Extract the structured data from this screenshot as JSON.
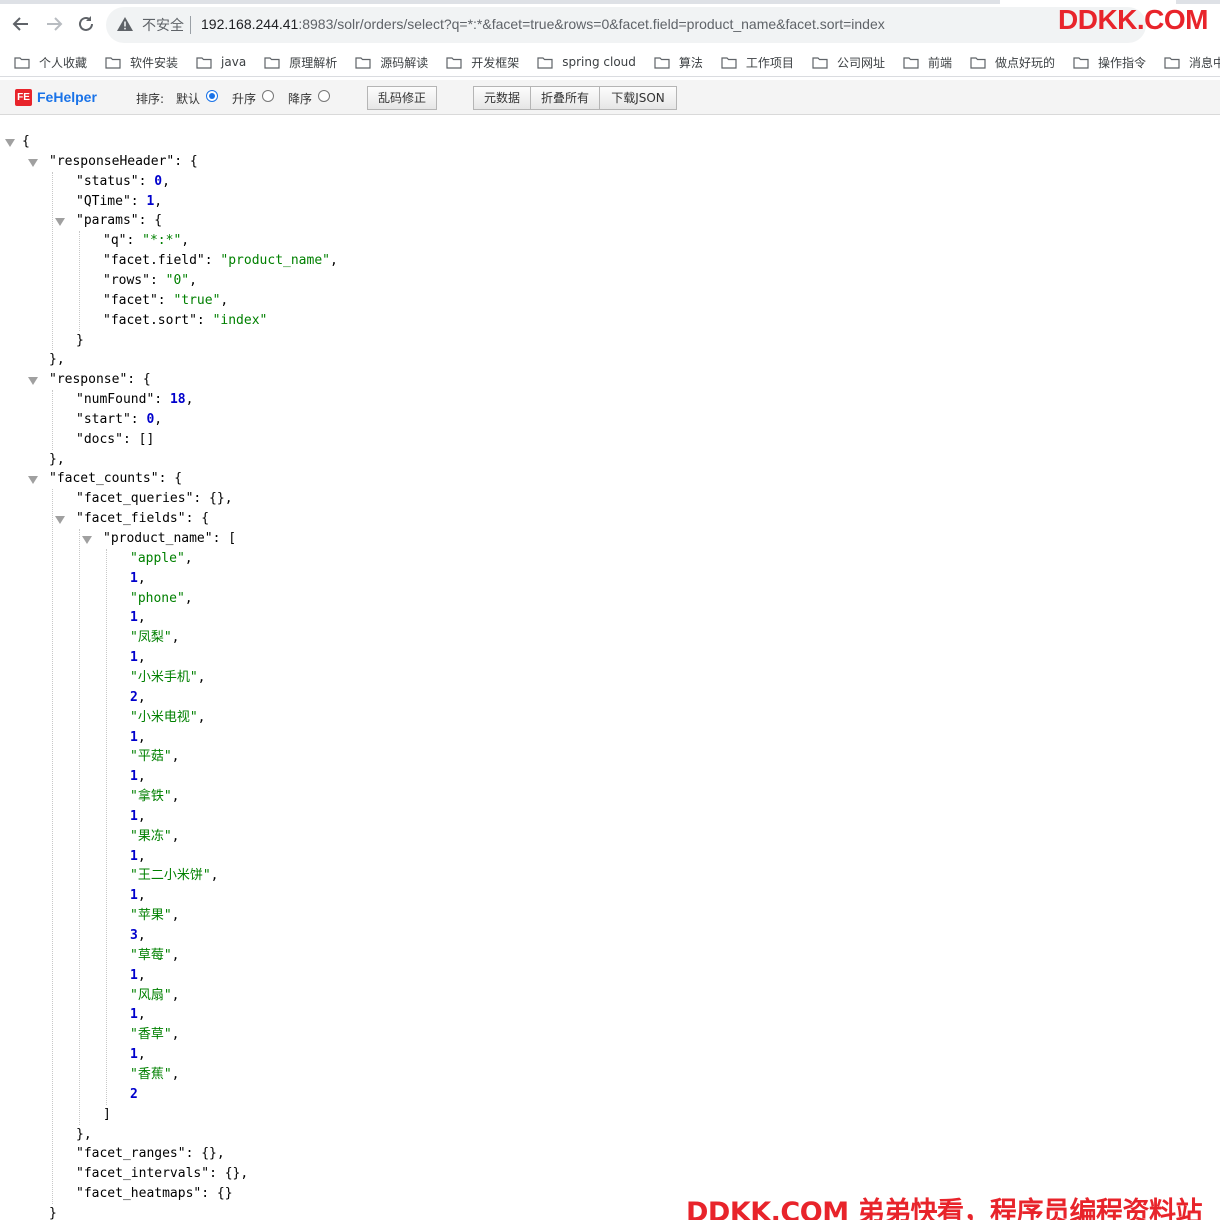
{
  "address_bar": {
    "security_label": "不安全",
    "url_host": "192.168.244.41",
    "url_rest": ":8983/solr/orders/select?q=*:*&facet=true&rows=0&facet.field=product_name&facet.sort=index"
  },
  "watermark_top": "DDKK.COM",
  "watermark_bottom": "DDKK.COM 弟弟快看，程序员编程资料站",
  "bookmarks": [
    "个人收藏",
    "软件安装",
    "java",
    "原理解析",
    "源码解读",
    "开发框架",
    "spring cloud",
    "算法",
    "工作项目",
    "公司网址",
    "前端",
    "做点好玩的",
    "操作指令",
    "消息中间件"
  ],
  "fehelper": {
    "brand": "FeHelper",
    "logo_text": "FE",
    "sort_label": "排序:",
    "sort_default": "默认",
    "sort_asc": "升序",
    "sort_desc": "降序",
    "sort_selected": "默认",
    "fix_encoding": "乱码修正",
    "metadata": "元数据",
    "collapse_all": "折叠所有",
    "download_json": "下载JSON"
  },
  "json_lines": [
    {
      "indent": 0,
      "tokens": [
        [
          "p",
          "{"
        ]
      ]
    },
    {
      "indent": 1,
      "tokens": [
        [
          "k",
          "\"responseHeader\""
        ],
        [
          "p",
          ": {"
        ]
      ]
    },
    {
      "indent": 2,
      "tokens": [
        [
          "k",
          "\"status\""
        ],
        [
          "p",
          ": "
        ],
        [
          "n",
          "0"
        ],
        [
          "p",
          ","
        ]
      ]
    },
    {
      "indent": 2,
      "tokens": [
        [
          "k",
          "\"QTime\""
        ],
        [
          "p",
          ": "
        ],
        [
          "n",
          "1"
        ],
        [
          "p",
          ","
        ]
      ]
    },
    {
      "indent": 2,
      "tokens": [
        [
          "k",
          "\"params\""
        ],
        [
          "p",
          ": {"
        ]
      ]
    },
    {
      "indent": 3,
      "tokens": [
        [
          "k",
          "\"q\""
        ],
        [
          "p",
          ": "
        ],
        [
          "s",
          "\"*:*\""
        ],
        [
          "p",
          ","
        ]
      ]
    },
    {
      "indent": 3,
      "tokens": [
        [
          "k",
          "\"facet.field\""
        ],
        [
          "p",
          ": "
        ],
        [
          "s",
          "\"product_name\""
        ],
        [
          "p",
          ","
        ]
      ]
    },
    {
      "indent": 3,
      "tokens": [
        [
          "k",
          "\"rows\""
        ],
        [
          "p",
          ": "
        ],
        [
          "s",
          "\"0\""
        ],
        [
          "p",
          ","
        ]
      ]
    },
    {
      "indent": 3,
      "tokens": [
        [
          "k",
          "\"facet\""
        ],
        [
          "p",
          ": "
        ],
        [
          "s",
          "\"true\""
        ],
        [
          "p",
          ","
        ]
      ]
    },
    {
      "indent": 3,
      "tokens": [
        [
          "k",
          "\"facet.sort\""
        ],
        [
          "p",
          ": "
        ],
        [
          "s",
          "\"index\""
        ]
      ]
    },
    {
      "indent": 2,
      "tokens": [
        [
          "p",
          "}"
        ]
      ]
    },
    {
      "indent": 1,
      "tokens": [
        [
          "p",
          "},"
        ]
      ]
    },
    {
      "indent": 1,
      "tokens": [
        [
          "k",
          "\"response\""
        ],
        [
          "p",
          ": {"
        ]
      ]
    },
    {
      "indent": 2,
      "tokens": [
        [
          "k",
          "\"numFound\""
        ],
        [
          "p",
          ": "
        ],
        [
          "n",
          "18"
        ],
        [
          "p",
          ","
        ]
      ]
    },
    {
      "indent": 2,
      "tokens": [
        [
          "k",
          "\"start\""
        ],
        [
          "p",
          ": "
        ],
        [
          "n",
          "0"
        ],
        [
          "p",
          ","
        ]
      ]
    },
    {
      "indent": 2,
      "tokens": [
        [
          "k",
          "\"docs\""
        ],
        [
          "p",
          ": []"
        ]
      ]
    },
    {
      "indent": 1,
      "tokens": [
        [
          "p",
          "},"
        ]
      ]
    },
    {
      "indent": 1,
      "tokens": [
        [
          "k",
          "\"facet_counts\""
        ],
        [
          "p",
          ": {"
        ]
      ]
    },
    {
      "indent": 2,
      "tokens": [
        [
          "k",
          "\"facet_queries\""
        ],
        [
          "p",
          ": {},"
        ]
      ]
    },
    {
      "indent": 2,
      "tokens": [
        [
          "k",
          "\"facet_fields\""
        ],
        [
          "p",
          ": {"
        ]
      ]
    },
    {
      "indent": 3,
      "tokens": [
        [
          "k",
          "\"product_name\""
        ],
        [
          "p",
          ": ["
        ]
      ]
    },
    {
      "indent": 4,
      "tokens": [
        [
          "s",
          "\"apple\""
        ],
        [
          "p",
          ","
        ]
      ]
    },
    {
      "indent": 4,
      "tokens": [
        [
          "n",
          "1"
        ],
        [
          "p",
          ","
        ]
      ]
    },
    {
      "indent": 4,
      "tokens": [
        [
          "s",
          "\"phone\""
        ],
        [
          "p",
          ","
        ]
      ]
    },
    {
      "indent": 4,
      "tokens": [
        [
          "n",
          "1"
        ],
        [
          "p",
          ","
        ]
      ]
    },
    {
      "indent": 4,
      "tokens": [
        [
          "s",
          "\"凤梨\""
        ],
        [
          "p",
          ","
        ]
      ]
    },
    {
      "indent": 4,
      "tokens": [
        [
          "n",
          "1"
        ],
        [
          "p",
          ","
        ]
      ]
    },
    {
      "indent": 4,
      "tokens": [
        [
          "s",
          "\"小米手机\""
        ],
        [
          "p",
          ","
        ]
      ]
    },
    {
      "indent": 4,
      "tokens": [
        [
          "n",
          "2"
        ],
        [
          "p",
          ","
        ]
      ]
    },
    {
      "indent": 4,
      "tokens": [
        [
          "s",
          "\"小米电视\""
        ],
        [
          "p",
          ","
        ]
      ]
    },
    {
      "indent": 4,
      "tokens": [
        [
          "n",
          "1"
        ],
        [
          "p",
          ","
        ]
      ]
    },
    {
      "indent": 4,
      "tokens": [
        [
          "s",
          "\"平菇\""
        ],
        [
          "p",
          ","
        ]
      ]
    },
    {
      "indent": 4,
      "tokens": [
        [
          "n",
          "1"
        ],
        [
          "p",
          ","
        ]
      ]
    },
    {
      "indent": 4,
      "tokens": [
        [
          "s",
          "\"拿铁\""
        ],
        [
          "p",
          ","
        ]
      ]
    },
    {
      "indent": 4,
      "tokens": [
        [
          "n",
          "1"
        ],
        [
          "p",
          ","
        ]
      ]
    },
    {
      "indent": 4,
      "tokens": [
        [
          "s",
          "\"果冻\""
        ],
        [
          "p",
          ","
        ]
      ]
    },
    {
      "indent": 4,
      "tokens": [
        [
          "n",
          "1"
        ],
        [
          "p",
          ","
        ]
      ]
    },
    {
      "indent": 4,
      "tokens": [
        [
          "s",
          "\"王二小米饼\""
        ],
        [
          "p",
          ","
        ]
      ]
    },
    {
      "indent": 4,
      "tokens": [
        [
          "n",
          "1"
        ],
        [
          "p",
          ","
        ]
      ]
    },
    {
      "indent": 4,
      "tokens": [
        [
          "s",
          "\"苹果\""
        ],
        [
          "p",
          ","
        ]
      ]
    },
    {
      "indent": 4,
      "tokens": [
        [
          "n",
          "3"
        ],
        [
          "p",
          ","
        ]
      ]
    },
    {
      "indent": 4,
      "tokens": [
        [
          "s",
          "\"草莓\""
        ],
        [
          "p",
          ","
        ]
      ]
    },
    {
      "indent": 4,
      "tokens": [
        [
          "n",
          "1"
        ],
        [
          "p",
          ","
        ]
      ]
    },
    {
      "indent": 4,
      "tokens": [
        [
          "s",
          "\"风扇\""
        ],
        [
          "p",
          ","
        ]
      ]
    },
    {
      "indent": 4,
      "tokens": [
        [
          "n",
          "1"
        ],
        [
          "p",
          ","
        ]
      ]
    },
    {
      "indent": 4,
      "tokens": [
        [
          "s",
          "\"香草\""
        ],
        [
          "p",
          ","
        ]
      ]
    },
    {
      "indent": 4,
      "tokens": [
        [
          "n",
          "1"
        ],
        [
          "p",
          ","
        ]
      ]
    },
    {
      "indent": 4,
      "tokens": [
        [
          "s",
          "\"香蕉\""
        ],
        [
          "p",
          ","
        ]
      ]
    },
    {
      "indent": 4,
      "tokens": [
        [
          "n",
          "2"
        ]
      ]
    },
    {
      "indent": 3,
      "tokens": [
        [
          "p",
          "]"
        ]
      ]
    },
    {
      "indent": 2,
      "tokens": [
        [
          "p",
          "},"
        ]
      ]
    },
    {
      "indent": 2,
      "tokens": [
        [
          "k",
          "\"facet_ranges\""
        ],
        [
          "p",
          ": {},"
        ]
      ]
    },
    {
      "indent": 2,
      "tokens": [
        [
          "k",
          "\"facet_intervals\""
        ],
        [
          "p",
          ": {},"
        ]
      ]
    },
    {
      "indent": 2,
      "tokens": [
        [
          "k",
          "\"facet_heatmaps\""
        ],
        [
          "p",
          ": {}"
        ]
      ]
    },
    {
      "indent": 1,
      "tokens": [
        [
          "p",
          "}"
        ]
      ]
    }
  ]
}
